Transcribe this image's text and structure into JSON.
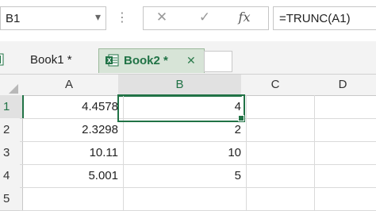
{
  "formula_bar": {
    "name_box": "B1",
    "name_box_dropdown": "▾",
    "separator": "⋮",
    "cancel_glyph": "✕",
    "enter_glyph": "✓",
    "fx_label": "fx",
    "formula": "=TRUNC(A1)"
  },
  "tabs": [
    {
      "label": "Book1 *",
      "active": false
    },
    {
      "label": "Book2 *",
      "active": true,
      "close": "✕"
    }
  ],
  "grid": {
    "columns": [
      "A",
      "B",
      "C",
      "D"
    ],
    "rows": [
      "1",
      "2",
      "3",
      "4",
      "5"
    ],
    "cells": [
      [
        "4.4578",
        "4",
        "",
        ""
      ],
      [
        "2.3298",
        "2",
        "",
        ""
      ],
      [
        "10.11",
        "10",
        "",
        ""
      ],
      [
        "5.001",
        "5",
        "",
        ""
      ],
      [
        "",
        "",
        "",
        ""
      ]
    ],
    "selected_cell": "B1"
  },
  "colors": {
    "accent": "#217346",
    "active_tab_bg": "#d7e4d7",
    "header_bg": "#f3f3f3"
  }
}
